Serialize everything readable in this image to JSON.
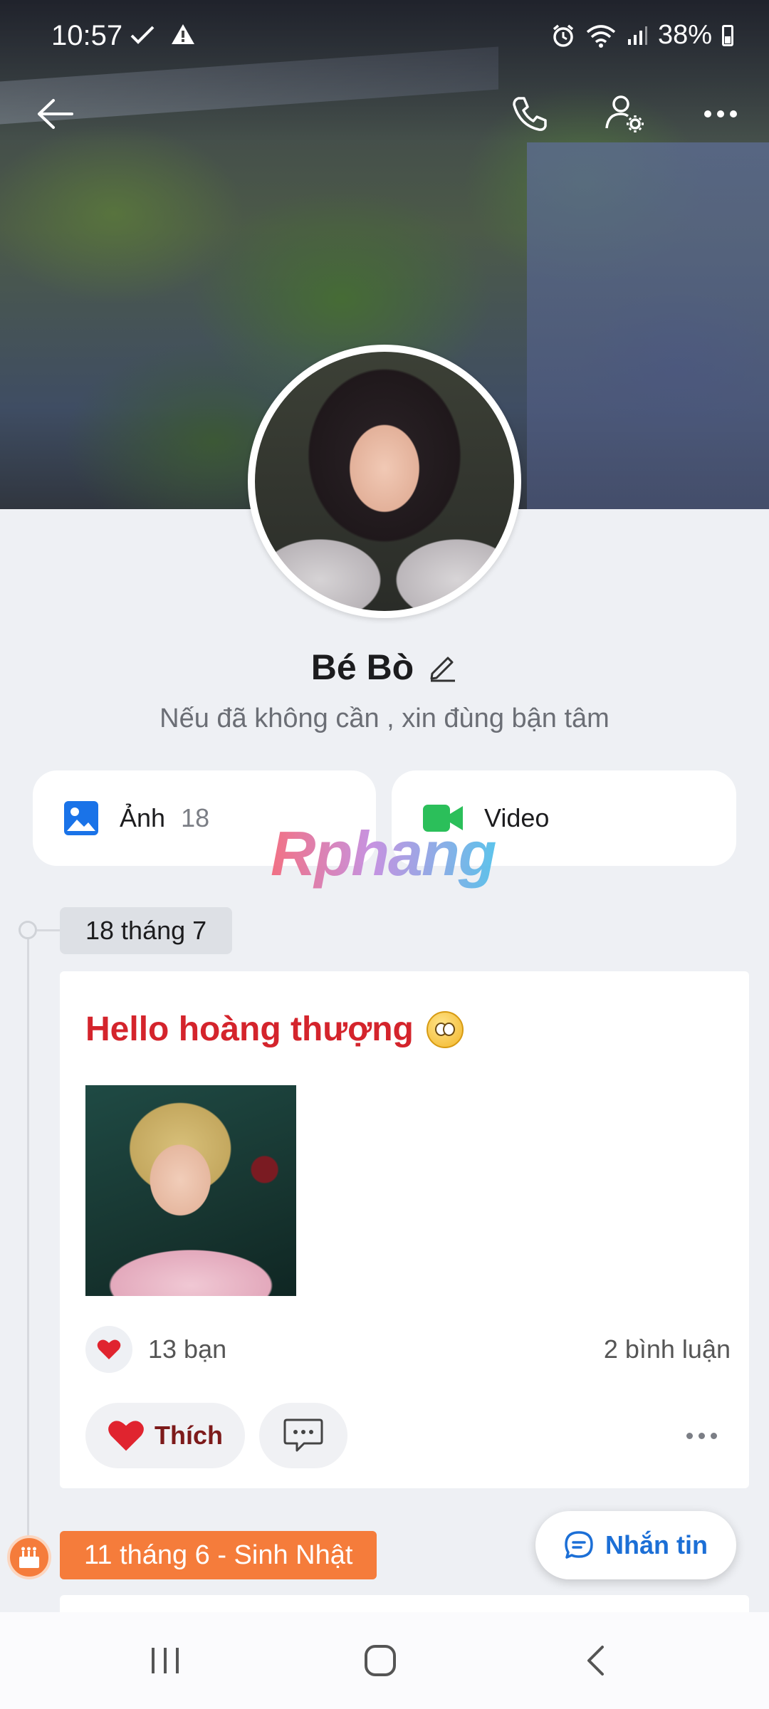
{
  "status_bar": {
    "time": "10:57",
    "battery": "38%"
  },
  "profile": {
    "name": "Bé Bò",
    "bio": "Nếu đã không cần ,  xin đùng bận tâm"
  },
  "media": {
    "photos_label": "Ảnh",
    "photos_count": "18",
    "video_label": "Video"
  },
  "watermark": "Rphang",
  "timeline": {
    "date": "18 tháng 7",
    "post": {
      "title": "Hello hoàng thượng",
      "reactions": "13 bạn",
      "comments": "2 bình luận",
      "like_label": "Thích"
    },
    "birthday_date": "11 tháng 6 - Sinh Nhật"
  },
  "message_button": "Nhắn tin",
  "colors": {
    "accent": "#1c6fd6",
    "post_title": "#d4242c",
    "birthday": "#f57c3b",
    "photo_icon": "#1a73e8",
    "video_icon": "#2bbf5a"
  }
}
